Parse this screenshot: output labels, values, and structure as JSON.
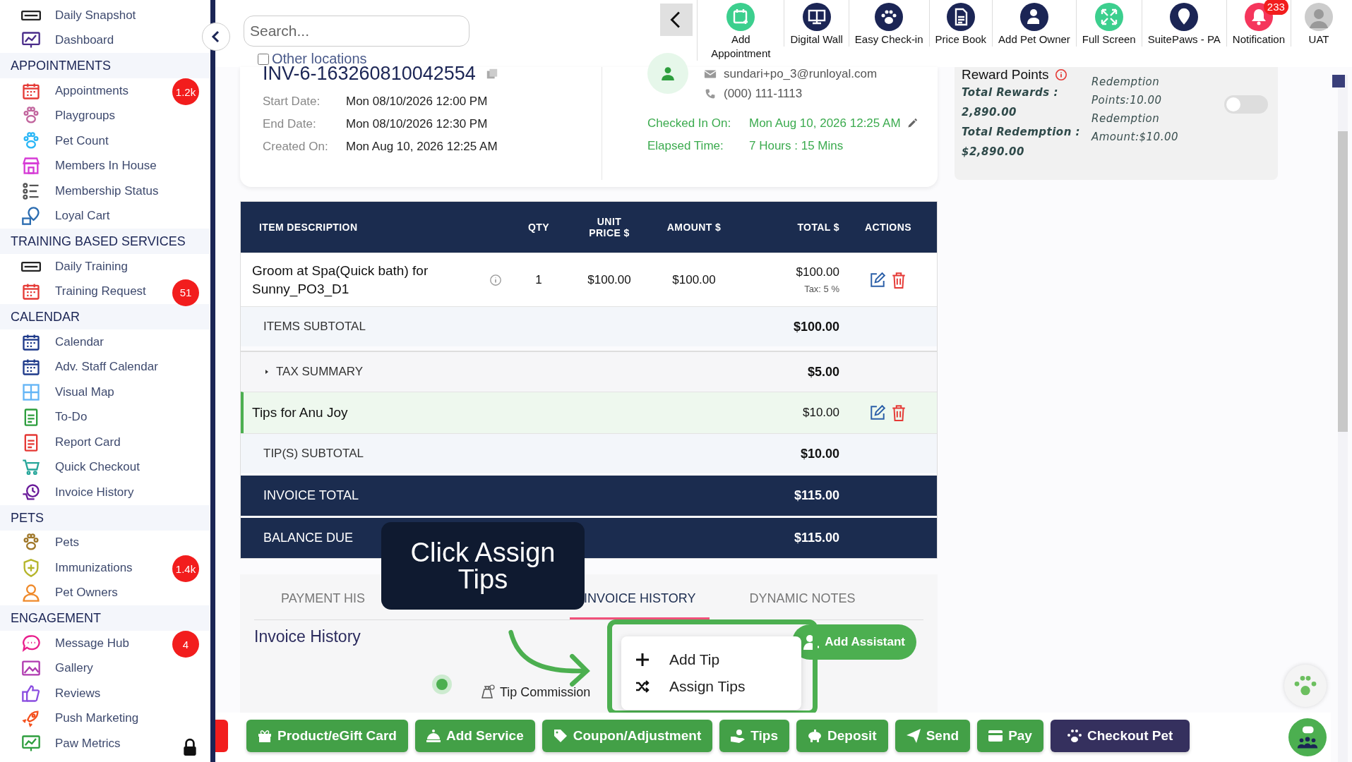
{
  "sidebar": {
    "sections": [
      {
        "items": [
          {
            "label": "Daily Snapshot",
            "color": "#222222"
          },
          {
            "label": "Dashboard",
            "color": "#4a2c8a"
          }
        ]
      },
      {
        "header": "APPOINTMENTS",
        "items": [
          {
            "label": "Appointments",
            "color": "#e53935",
            "badge": "1.2k"
          },
          {
            "label": "Playgroups",
            "color": "#c2669e"
          },
          {
            "label": "Pet Count",
            "color": "#29b6f6"
          },
          {
            "label": "Members In House",
            "color": "#d63ad6"
          },
          {
            "label": "Membership Status",
            "color": "#555555"
          },
          {
            "label": "Loyal Cart",
            "color": "#2b6cb0"
          }
        ]
      },
      {
        "header": "TRAINING BASED SERVICES",
        "items": [
          {
            "label": "Daily Training",
            "color": "#222222"
          },
          {
            "label": "Training Request",
            "color": "#e53935",
            "badge": "51"
          }
        ]
      },
      {
        "header": "CALENDAR",
        "items": [
          {
            "label": "Calendar",
            "color": "#1e3a8a"
          },
          {
            "label": "Adv. Staff Calendar",
            "color": "#1e3a8a"
          },
          {
            "label": "Visual Map",
            "color": "#64b5f6"
          },
          {
            "label": "To-Do",
            "color": "#2e9e3e"
          },
          {
            "label": "Report Card",
            "color": "#e53935"
          },
          {
            "label": "Quick Checkout",
            "color": "#26a69a"
          },
          {
            "label": "Invoice History",
            "color": "#6a1b9a"
          }
        ]
      },
      {
        "header": "PETS",
        "items": [
          {
            "label": "Pets",
            "color": "#a0782a"
          },
          {
            "label": "Immunizations",
            "color": "#b5b52a",
            "badge": "1.4k"
          },
          {
            "label": "Pet Owners",
            "color": "#ef8a2b"
          }
        ]
      },
      {
        "header": "ENGAGEMENT",
        "items": [
          {
            "label": "Message Hub",
            "color": "#e91e8c",
            "badge": "4"
          },
          {
            "label": "Gallery",
            "color": "#b03ab0"
          },
          {
            "label": "Reviews",
            "color": "#8a4de0"
          },
          {
            "label": "Push Marketing",
            "color": "#f4511e"
          },
          {
            "label": "Paw Metrics",
            "color": "#2e9e3e",
            "locked": true
          }
        ]
      }
    ]
  },
  "search": {
    "placeholder": "Search..."
  },
  "other_locations": {
    "label": "Other locations",
    "checked": false
  },
  "toolbar": [
    {
      "label": "Add Appointment",
      "color": "#3ccf8e"
    },
    {
      "label": "Digital Wall",
      "color": "#1b2555"
    },
    {
      "label": "Easy Check-in",
      "color": "#1b2555"
    },
    {
      "label": "Price Book",
      "color": "#1b2555"
    },
    {
      "label": "Add Pet Owner",
      "color": "#1b2555"
    },
    {
      "label": "Full Screen",
      "color": "#3ccf8e"
    },
    {
      "label": "SuitePaws - PA",
      "color": "#1b2555"
    },
    {
      "label": "Notification",
      "color": "#f5365c",
      "badge": "233"
    },
    {
      "label": "UAT",
      "color": "#cccccc"
    }
  ],
  "invoice": {
    "number": "INV-6-163260810042554",
    "details": [
      {
        "label": "Start Date:",
        "value": "Mon 08/10/2026 12:00 PM"
      },
      {
        "label": "End Date:",
        "value": "Mon 08/10/2026 12:30 PM"
      },
      {
        "label": "Created On:",
        "value": "Mon Aug 10, 2026 12:25 AM"
      }
    ],
    "email": "sundari+po_3@runloyal.com",
    "phone": "(000) 111-1113",
    "status": [
      {
        "label": "Checked In On:",
        "value": "Mon Aug 10, 2026 12:25 AM",
        "editable": true
      },
      {
        "label": "Elapsed Time:",
        "value": "7 Hours : 15 Mins",
        "editable": false
      }
    ]
  },
  "rewards": {
    "title": "Reward Points",
    "total_rewards_label": "Total Rewards :",
    "total_rewards": "2,890.00",
    "total_redemption_label": "Total Redemption :",
    "total_redemption": "$2,890.00",
    "redemption_points": "Redemption Points:10.00",
    "redemption_amount": "Redemption Amount:$10.00",
    "on": false
  },
  "table": {
    "columns": [
      "ITEM DESCRIPTION",
      "QTY",
      "UNIT PRICE $",
      "AMOUNT $",
      "TOTAL $",
      "ACTIONS"
    ],
    "rows": [
      {
        "kind": "item",
        "description": "Groom at Spa(Quick bath) for Sunny_PO3_D1",
        "qty": "1",
        "unit_price": "$100.00",
        "amount": "$100.00",
        "total": "$100.00",
        "tax": "Tax: 5 %"
      },
      {
        "kind": "subtotal",
        "label": "ITEMS SUBTOTAL",
        "total": "$100.00"
      },
      {
        "kind": "tax_summary",
        "label": "TAX SUMMARY",
        "total": "$5.00",
        "expanded": false
      },
      {
        "kind": "tip",
        "description": "Tips for Anu Joy",
        "total": "$10.00"
      },
      {
        "kind": "subtotal",
        "label": "TIP(S) SUBTOTAL",
        "total": "$10.00"
      },
      {
        "kind": "grand",
        "label": "INVOICE TOTAL",
        "total": "$115.00"
      },
      {
        "kind": "grand",
        "label": "BALANCE DUE",
        "total": "$115.00"
      }
    ]
  },
  "tabs": [
    {
      "label": "PAYMENT HIS",
      "selected": false
    },
    {
      "label": "INVOICE HISTORY",
      "selected": true
    },
    {
      "label": "DYNAMIC NOTES",
      "selected": false
    }
  ],
  "history": {
    "title": "Invoice History",
    "add_assistant": "Add Assistant",
    "timeline": [
      {
        "label": "Tip Commission"
      }
    ]
  },
  "guide": {
    "tooltip": "Click Assign Tips",
    "menu": [
      {
        "label": "Add Tip"
      },
      {
        "label": "Assign Tips"
      }
    ]
  },
  "actions": [
    {
      "label": "Product/eGift Card",
      "kind": "green"
    },
    {
      "label": "Add Service",
      "kind": "green"
    },
    {
      "label": "Coupon/Adjustment",
      "kind": "green"
    },
    {
      "label": "Tips",
      "kind": "green"
    },
    {
      "label": "Deposit",
      "kind": "green"
    },
    {
      "label": "Send",
      "kind": "green"
    },
    {
      "label": "Pay",
      "kind": "green"
    },
    {
      "label": "Checkout Pet",
      "kind": "dark"
    }
  ]
}
